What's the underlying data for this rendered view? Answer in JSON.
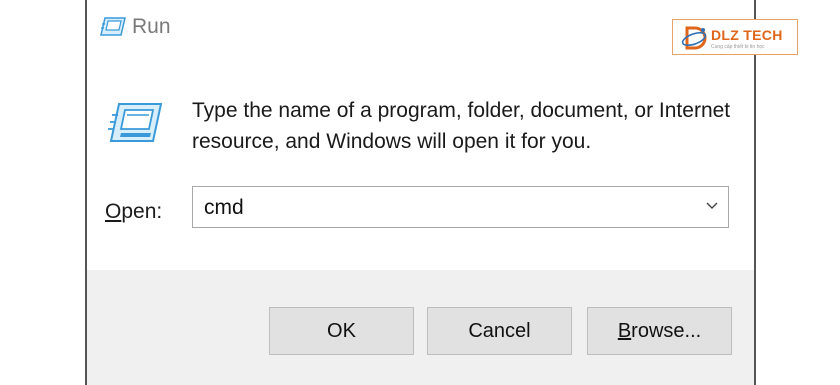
{
  "window": {
    "title": "Run"
  },
  "dialog": {
    "description": "Type the name of a program, folder, document, or Internet resource, and Windows will open it for you.",
    "open_label_mnemonic": "O",
    "open_label_rest": "pen:",
    "open_value": "cmd"
  },
  "buttons": {
    "ok": "OK",
    "cancel": "Cancel",
    "browse_mnemonic": "B",
    "browse_rest": "rowse..."
  },
  "watermark": {
    "brand": "DLZ TECH",
    "tagline": "Cung cấp thiết bị tin học"
  },
  "icons": {
    "title": "run-app-icon",
    "dialog": "run-app-icon",
    "dropdown": "chevron-down-icon",
    "watermark": "dlz-logo-icon"
  },
  "colors": {
    "footer": "#f0f0f0",
    "button": "#e1e1e1",
    "title_text": "#7a7a7a",
    "watermark_accent": "#e0651a",
    "icon_blue": "#3a9ad9"
  }
}
